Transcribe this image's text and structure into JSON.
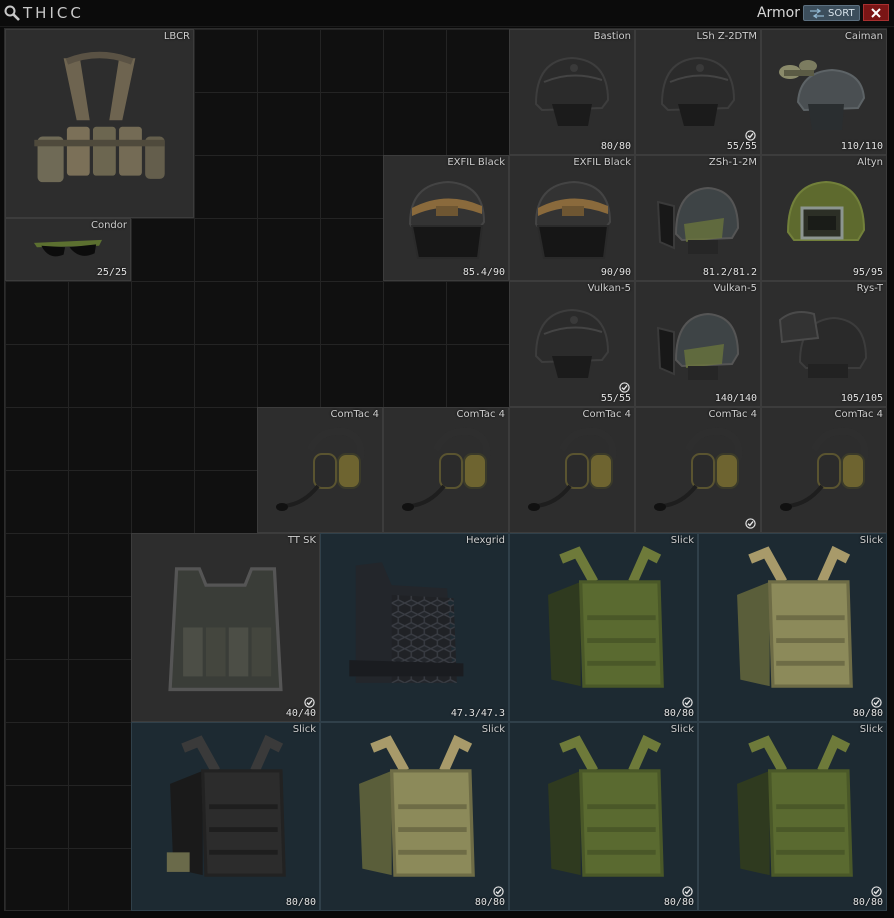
{
  "container": {
    "name": "THICC"
  },
  "toolbar": {
    "filter_label": "Armor",
    "sort_label": "SORT"
  },
  "colors": {
    "slot_gray": "#2d2d2d",
    "slot_blue": "#1d2a32",
    "close_red": "#7a1515",
    "sort_blue": "#3c4e5c"
  },
  "items": [
    {
      "name": "LBCR",
      "durability": "",
      "kind": "rig",
      "checked": false,
      "bg": "gray"
    },
    {
      "name": "Bastion",
      "durability": "80/80",
      "kind": "helmet",
      "checked": false,
      "bg": "gray"
    },
    {
      "name": "LSh Z-2DTM",
      "durability": "55/55",
      "kind": "helmet",
      "checked": true,
      "bg": "gray"
    },
    {
      "name": "Caiman",
      "durability": "110/110",
      "kind": "helmet-nvg",
      "checked": false,
      "bg": "gray"
    },
    {
      "name": "EXFIL Black",
      "durability": "85.4/90",
      "kind": "helmet-face",
      "checked": false,
      "bg": "gray"
    },
    {
      "name": "EXFIL Black",
      "durability": "90/90",
      "kind": "helmet-face",
      "checked": false,
      "bg": "gray"
    },
    {
      "name": "ZSh-1-2M",
      "durability": "81.2/81.2",
      "kind": "helmet-visor",
      "checked": false,
      "bg": "gray"
    },
    {
      "name": "Altyn",
      "durability": "95/95",
      "kind": "helmet-green",
      "checked": false,
      "bg": "gray"
    },
    {
      "name": "Condor",
      "durability": "25/25",
      "kind": "glasses",
      "checked": false,
      "bg": "gray"
    },
    {
      "name": "Vulkan-5",
      "durability": "55/55",
      "kind": "helmet",
      "checked": true,
      "bg": "gray"
    },
    {
      "name": "Vulkan-5",
      "durability": "140/140",
      "kind": "helmet-visor",
      "checked": false,
      "bg": "gray"
    },
    {
      "name": "Rys-T",
      "durability": "105/105",
      "kind": "helmet-visor-up",
      "checked": false,
      "bg": "gray"
    },
    {
      "name": "ComTac 4",
      "durability": "",
      "kind": "headset",
      "checked": false,
      "bg": "gray"
    },
    {
      "name": "ComTac 4",
      "durability": "",
      "kind": "headset",
      "checked": false,
      "bg": "gray"
    },
    {
      "name": "ComTac 4",
      "durability": "",
      "kind": "headset",
      "checked": false,
      "bg": "gray"
    },
    {
      "name": "ComTac 4",
      "durability": "",
      "kind": "headset",
      "checked": true,
      "bg": "gray"
    },
    {
      "name": "ComTac 4",
      "durability": "",
      "kind": "headset",
      "checked": false,
      "bg": "gray"
    },
    {
      "name": "TT SK",
      "durability": "40/40",
      "kind": "vest-camo",
      "checked": true,
      "bg": "gray"
    },
    {
      "name": "Hexgrid",
      "durability": "47.3/47.3",
      "kind": "vest-hex",
      "checked": false,
      "bg": "blue"
    },
    {
      "name": "Slick",
      "durability": "80/80",
      "kind": "vest-olive",
      "checked": true,
      "bg": "blue"
    },
    {
      "name": "Slick",
      "durability": "80/80",
      "kind": "vest-tan",
      "checked": true,
      "bg": "blue"
    },
    {
      "name": "Slick",
      "durability": "80/80",
      "kind": "vest-black",
      "checked": false,
      "bg": "blue"
    },
    {
      "name": "Slick",
      "durability": "80/80",
      "kind": "vest-tan",
      "checked": true,
      "bg": "blue"
    },
    {
      "name": "Slick",
      "durability": "80/80",
      "kind": "vest-olive",
      "checked": true,
      "bg": "blue"
    },
    {
      "name": "Slick",
      "durability": "80/80",
      "kind": "vest-olive",
      "checked": true,
      "bg": "blue"
    }
  ]
}
